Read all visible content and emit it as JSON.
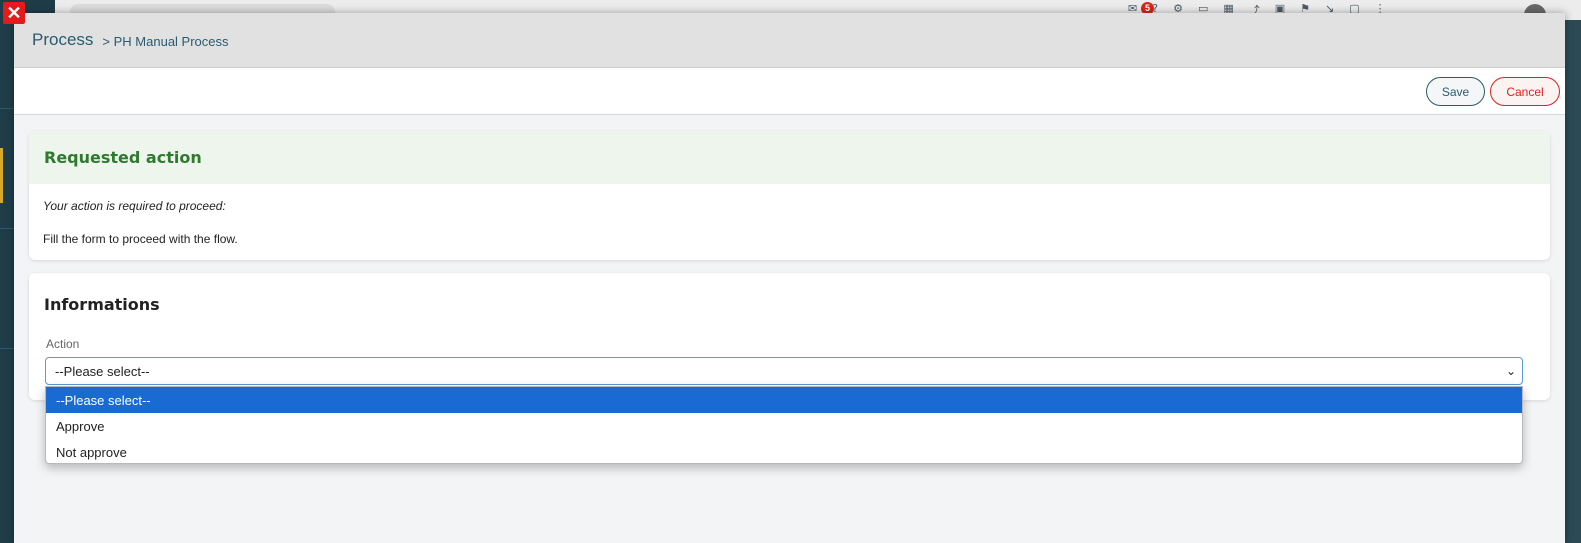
{
  "background": {
    "notification_count": "5"
  },
  "header": {
    "title": "Process",
    "breadcrumb": "> PH Manual Process"
  },
  "toolbar": {
    "save_label": "Save",
    "cancel_label": "Cancel"
  },
  "requested_action": {
    "title": "Requested action",
    "intro": "Your action is required to proceed:",
    "message": "Fill the form to proceed with the flow."
  },
  "informations": {
    "title": "Informations",
    "action_label": "Action",
    "action_value": "--Please select--",
    "options": [
      "--Please select--",
      "Approve",
      "Not approve"
    ]
  },
  "colors": {
    "accent": "#2a5b6e",
    "success": "#2f7a2f",
    "danger": "#d9251c",
    "selection": "#1a6ad3"
  }
}
